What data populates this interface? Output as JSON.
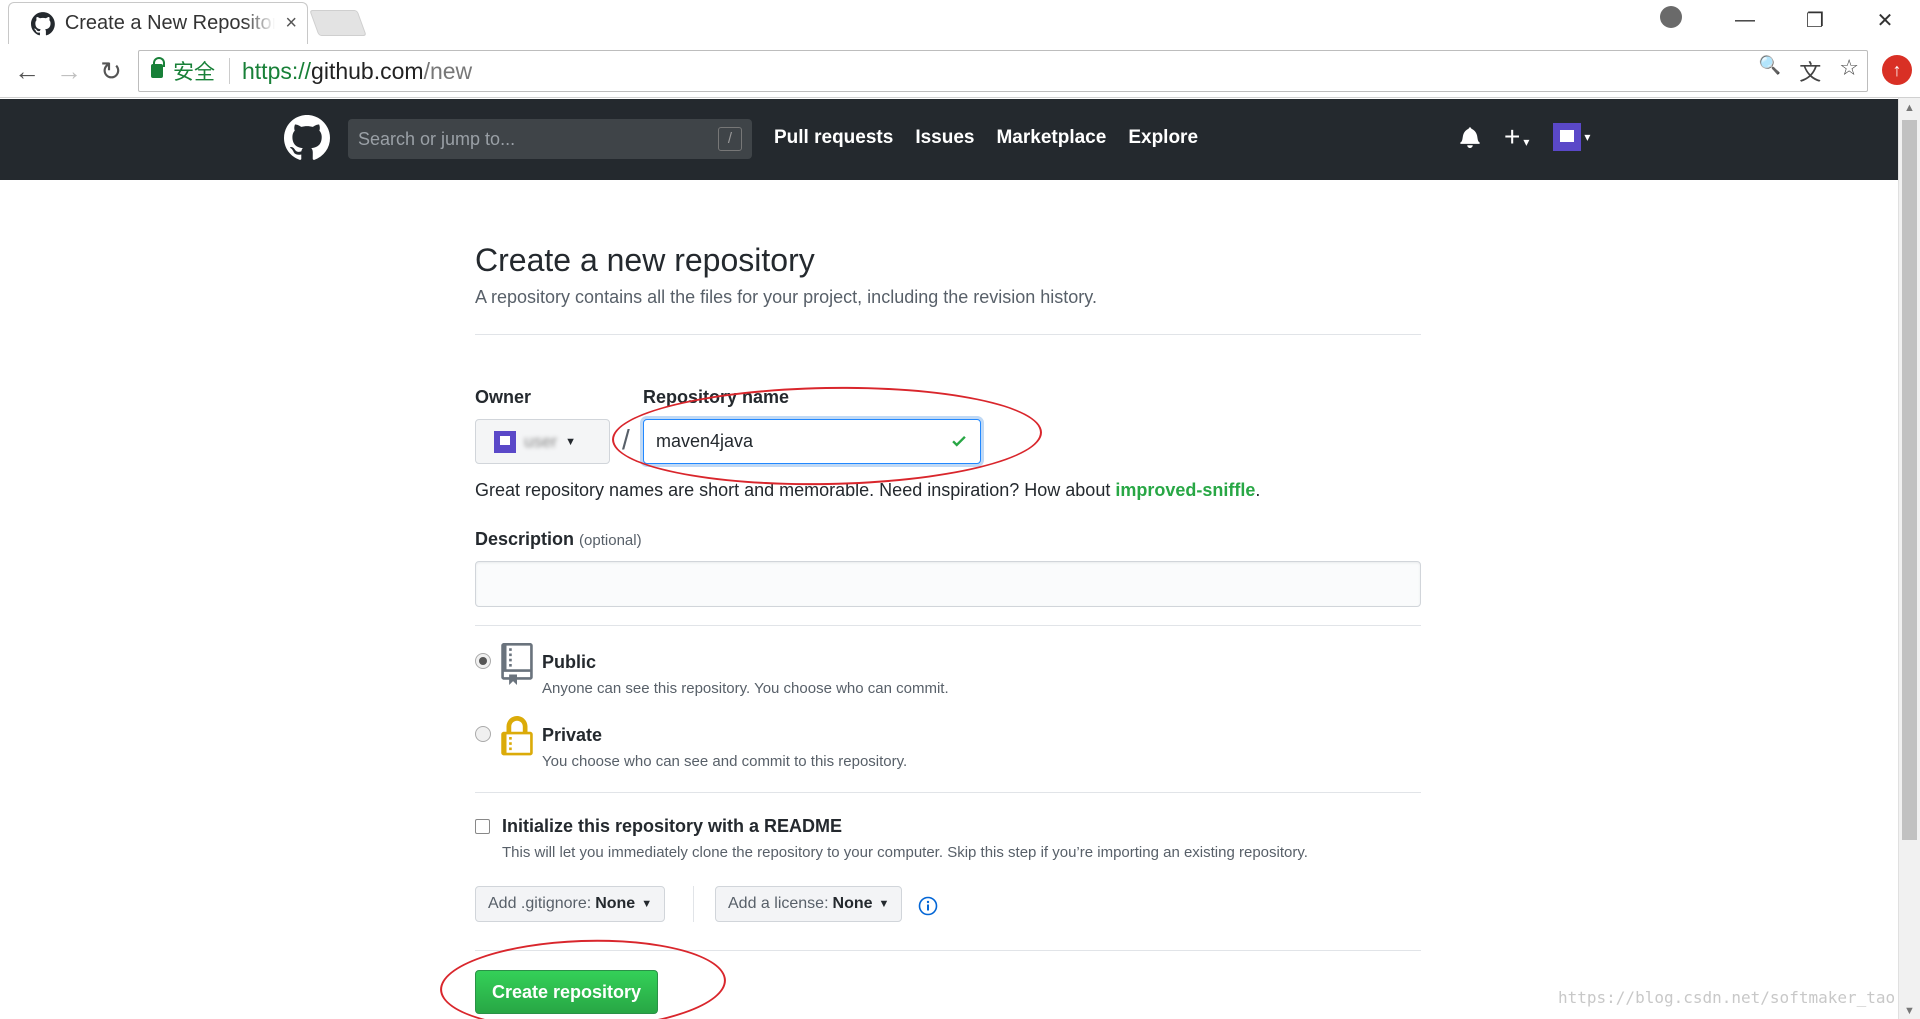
{
  "browser": {
    "tab_title": "Create a New Repository",
    "tab_close": "×",
    "secure_label": "安全",
    "url_scheme": "https://",
    "url_host": "github.com",
    "url_path": "/new",
    "win_min": "—",
    "win_restore": "❐",
    "win_close": "✕",
    "zoom_glyph": "🔍",
    "translate_glyph": "文",
    "star_glyph": "☆",
    "ext_glyph": "↑"
  },
  "github": {
    "search_placeholder": "Search or jump to...",
    "search_key": "/",
    "nav": [
      "Pull requests",
      "Issues",
      "Marketplace",
      "Explore"
    ]
  },
  "page": {
    "title": "Create a new repository",
    "subtitle": "A repository contains all the files for your project, including the revision history.",
    "owner_label": "Owner",
    "owner_name": "user",
    "slash": "/",
    "repo_label": "Repository name",
    "repo_value": "maven4java",
    "hint_prefix": "Great repository names are short and memorable. Need inspiration? How about ",
    "hint_suggestion": "improved-sniffle",
    "hint_suffix": ".",
    "desc_label": "Description",
    "desc_optional": "(optional)",
    "public_title": "Public",
    "public_desc": "Anyone can see this repository. You choose who can commit.",
    "private_title": "Private",
    "private_desc": "You choose who can see and commit to this repository.",
    "readme_title": "Initialize this repository with a README",
    "readme_desc": "This will let you immediately clone the repository to your computer. Skip this step if you’re importing an existing repository.",
    "gitignore_label": "Add .gitignore:",
    "gitignore_value": "None",
    "license_label": "Add a license:",
    "license_value": "None",
    "create_button": "Create repository"
  },
  "watermark": "https://blog.csdn.net/softmaker_tao",
  "colors": {
    "header_bg": "#24292e",
    "primary_green": "#28a745",
    "annotation_red": "#d9262c",
    "focus_blue": "#2188ff"
  }
}
